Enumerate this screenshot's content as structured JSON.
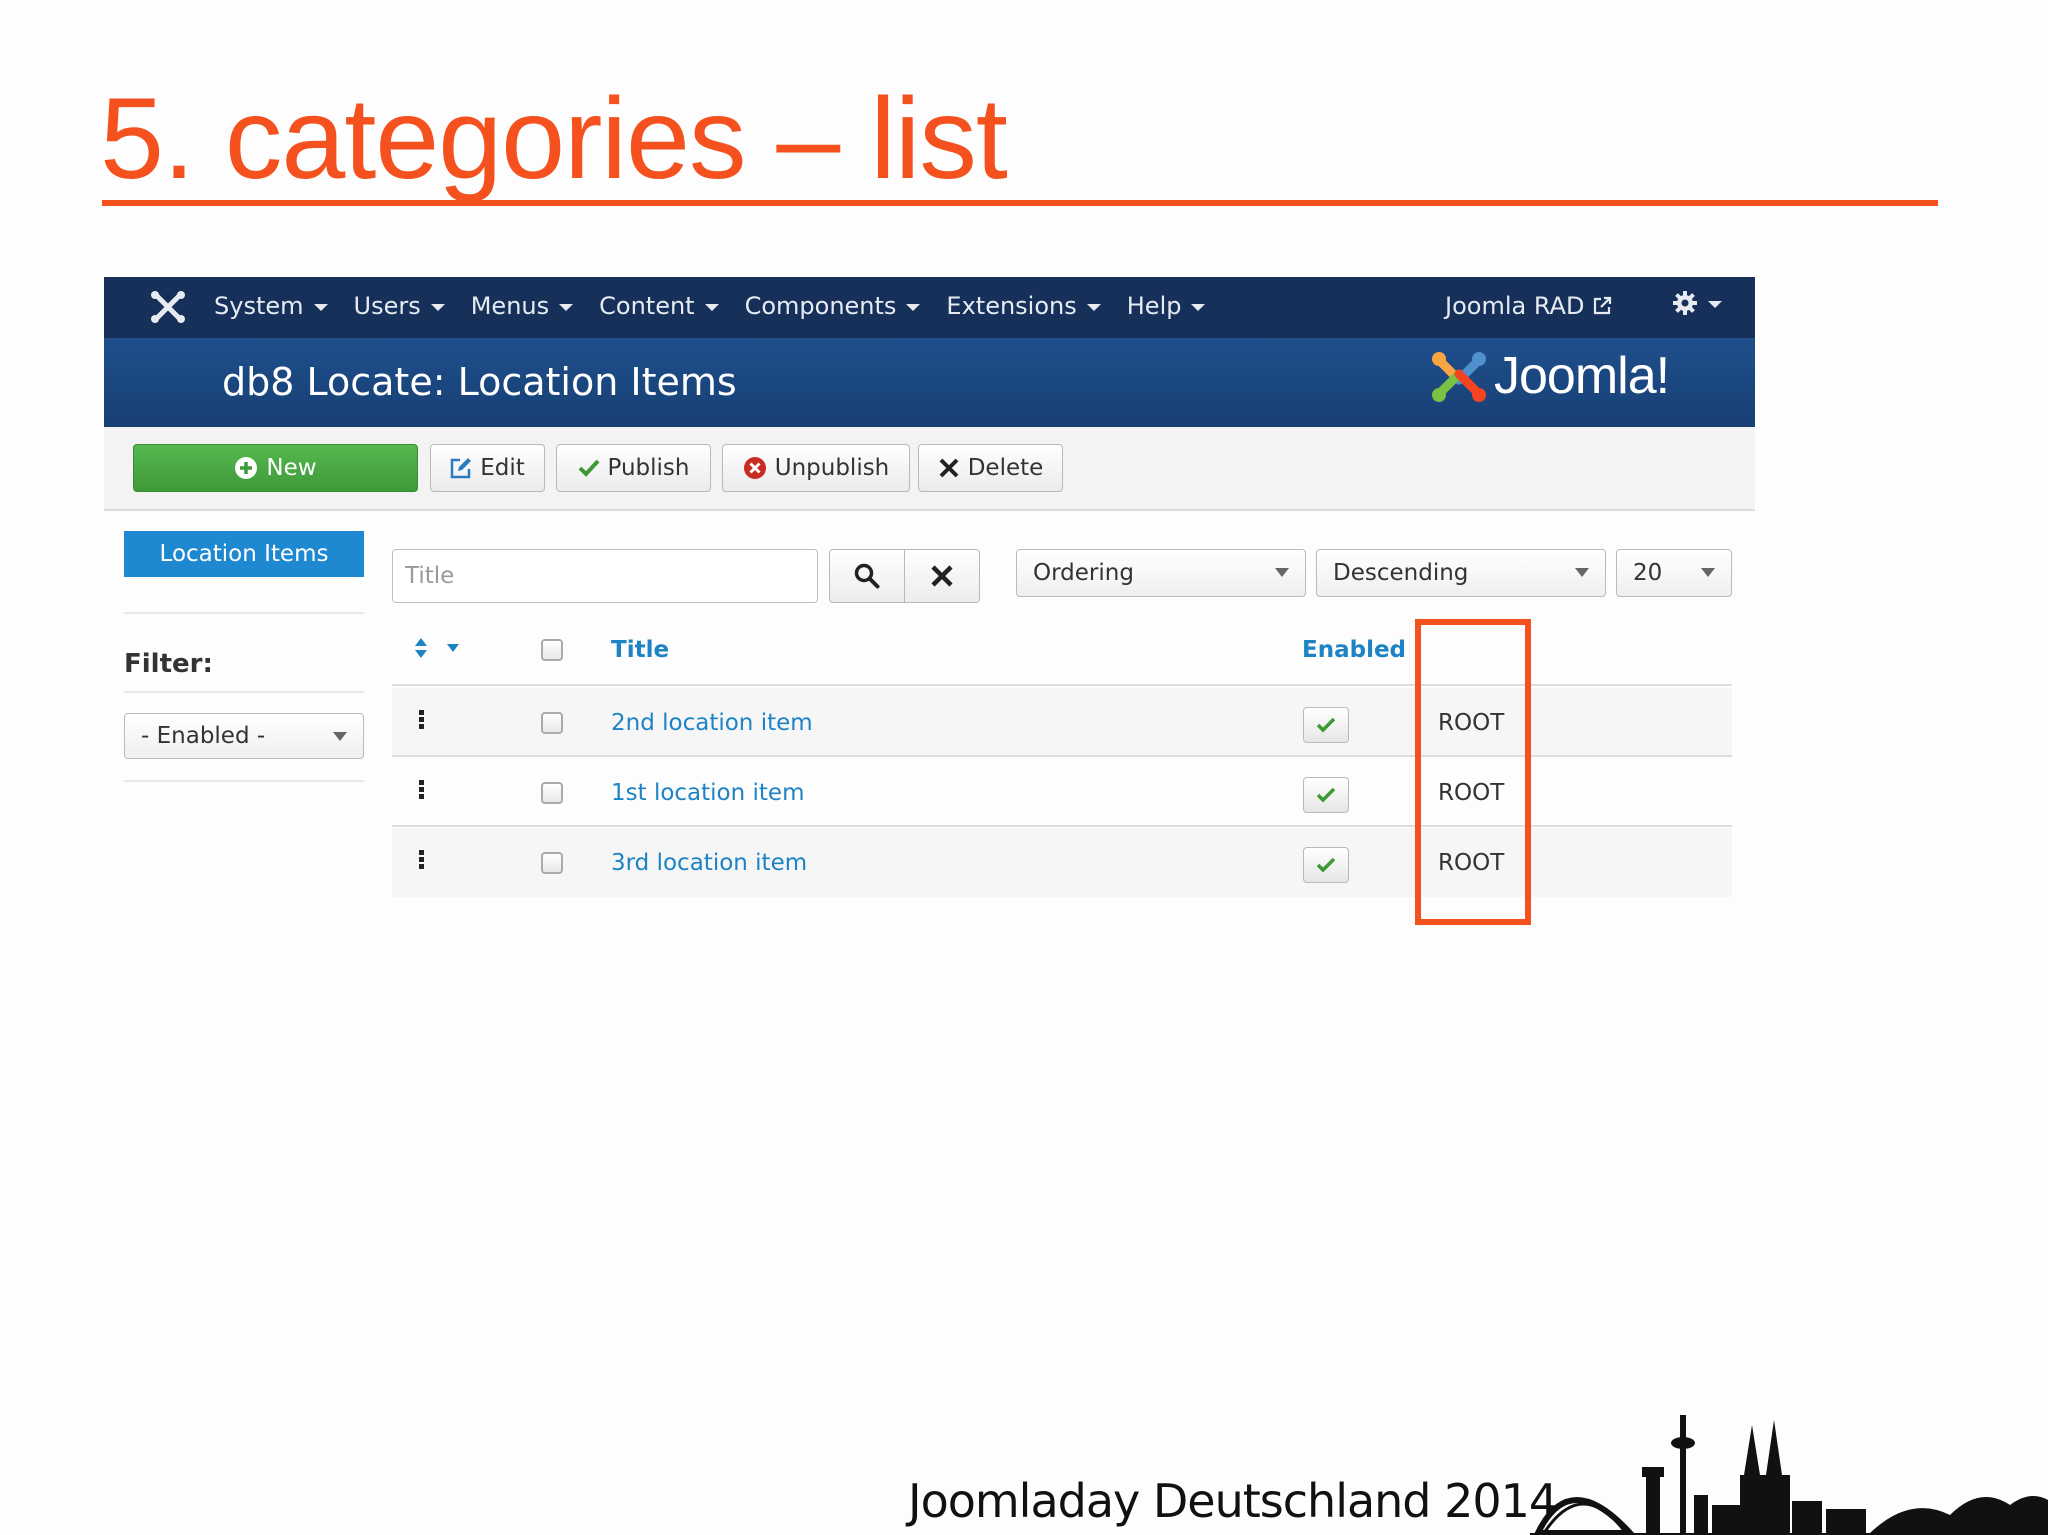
{
  "slide": {
    "title": "5. categories – list",
    "footer": "Joomladay Deutschland 2014",
    "accent_color": "#f4511e"
  },
  "navbar": {
    "logo_icon": "joomla-x-icon",
    "items": [
      {
        "label": "System"
      },
      {
        "label": "Users"
      },
      {
        "label": "Menus"
      },
      {
        "label": "Content"
      },
      {
        "label": "Components"
      },
      {
        "label": "Extensions"
      },
      {
        "label": "Help"
      }
    ],
    "site_link": "Joomla RAD",
    "site_link_icon": "external-link-icon",
    "settings_icon": "gear-icon"
  },
  "header": {
    "title": "db8 Locate: Location Items",
    "brand": "Joomla!"
  },
  "toolbar": {
    "new": "New",
    "edit": "Edit",
    "publish": "Publish",
    "unpublish": "Unpublish",
    "delete": "Delete"
  },
  "sidebar": {
    "active_item": "Location Items",
    "filter_label": "Filter:",
    "enabled_select": "- Enabled -"
  },
  "search": {
    "placeholder": "Title",
    "ordering": "Ordering",
    "direction": "Descending",
    "limit": "20"
  },
  "table": {
    "headers": {
      "title": "Title",
      "enabled": "Enabled"
    },
    "rows": [
      {
        "title": "2nd location item",
        "enabled": true,
        "category": "ROOT"
      },
      {
        "title": "1st location item",
        "enabled": true,
        "category": "ROOT"
      },
      {
        "title": "3rd location item",
        "enabled": true,
        "category": "ROOT"
      }
    ]
  }
}
